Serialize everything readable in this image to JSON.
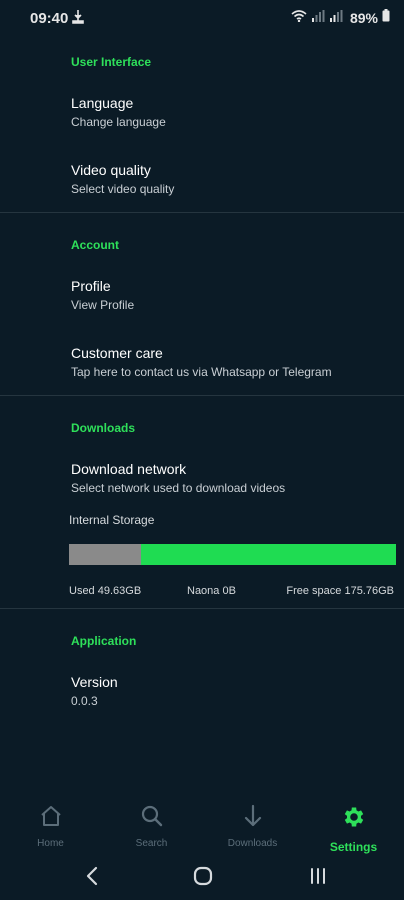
{
  "status_bar": {
    "time": "09:40",
    "battery": "89%"
  },
  "sections": {
    "user_interface": {
      "header": "User Interface",
      "language_title": "Language",
      "language_sub": "Change language",
      "video_title": "Video quality",
      "video_sub": "Select video quality"
    },
    "account": {
      "header": "Account",
      "profile_title": "Profile",
      "profile_sub": "View Profile",
      "care_title": "Customer care",
      "care_sub": "Tap here to contact us via Whatsapp or Telegram"
    },
    "downloads": {
      "header": "Downloads",
      "network_title": "Download network",
      "network_sub": "Select network used to download videos",
      "storage_label": "Internal Storage",
      "used": "Used 49.63GB",
      "naona": "Naona 0B",
      "free": "Free space 175.76GB",
      "used_fraction": 0.22
    },
    "application": {
      "header": "Application",
      "version_title": "Version",
      "version_value": "0.0.3"
    }
  },
  "bottom_nav": {
    "home": "Home",
    "search": "Search",
    "downloads": "Downloads",
    "settings": "Settings",
    "active": "settings"
  },
  "colors": {
    "accent": "#2ee05a",
    "background": "#0b1b26",
    "used_bar": "#8a8a8a"
  }
}
